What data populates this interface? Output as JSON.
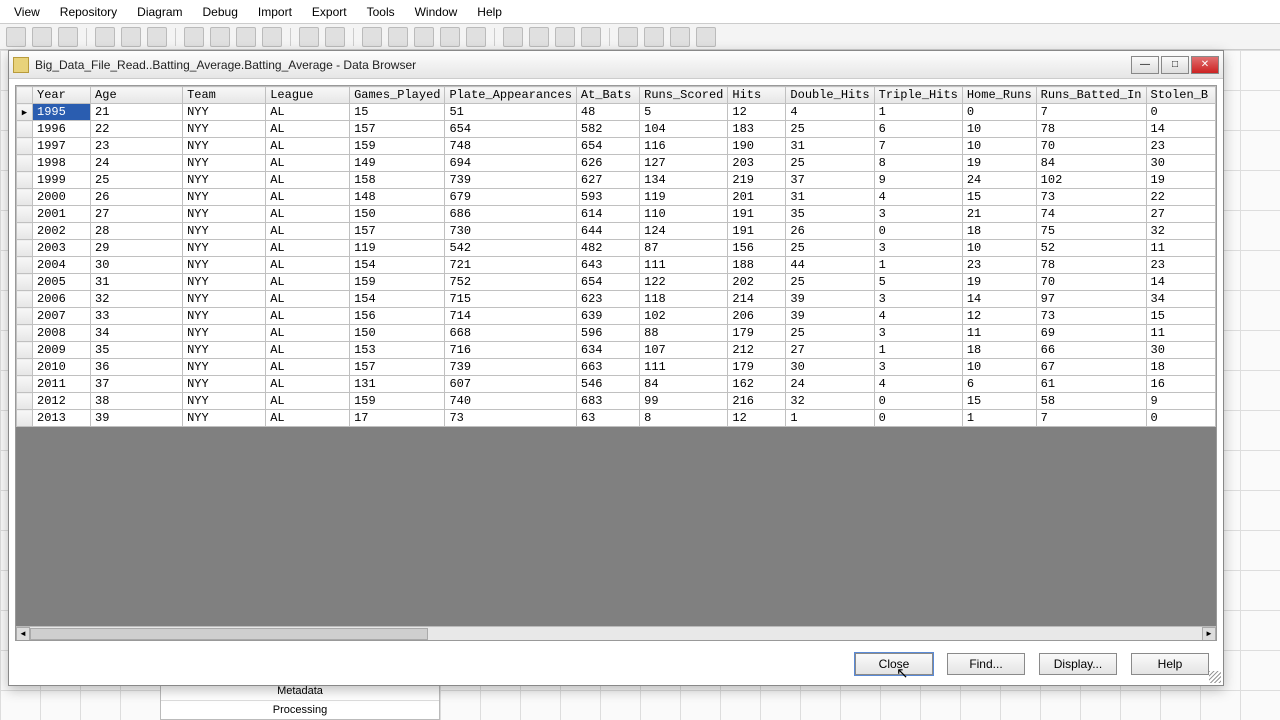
{
  "menubar": [
    "View",
    "Repository",
    "Diagram",
    "Debug",
    "Import",
    "Export",
    "Tools",
    "Window",
    "Help"
  ],
  "dialog": {
    "title": "Big_Data_File_Read..Batting_Average.Batting_Average - Data Browser"
  },
  "table": {
    "columns": [
      "Year",
      "Age",
      "Team",
      "League",
      "Games_Played",
      "Plate_Appearances",
      "At_Bats",
      "Runs_Scored",
      "Hits",
      "Double_Hits",
      "Triple_Hits",
      "Home_Runs",
      "Runs_Batted_In",
      "Stolen_B"
    ],
    "rows": [
      {
        "Year": "1995",
        "Age": "21",
        "Team": "NYY",
        "League": "AL",
        "Games_Played": "15",
        "Plate_Appearances": "51",
        "At_Bats": "48",
        "Runs_Scored": "5",
        "Hits": "12",
        "Double_Hits": "4",
        "Triple_Hits": "1",
        "Home_Runs": "0",
        "Runs_Batted_In": "7",
        "Stolen_B": "0"
      },
      {
        "Year": "1996",
        "Age": "22",
        "Team": "NYY",
        "League": "AL",
        "Games_Played": "157",
        "Plate_Appearances": "654",
        "At_Bats": "582",
        "Runs_Scored": "104",
        "Hits": "183",
        "Double_Hits": "25",
        "Triple_Hits": "6",
        "Home_Runs": "10",
        "Runs_Batted_In": "78",
        "Stolen_B": "14"
      },
      {
        "Year": "1997",
        "Age": "23",
        "Team": "NYY",
        "League": "AL",
        "Games_Played": "159",
        "Plate_Appearances": "748",
        "At_Bats": "654",
        "Runs_Scored": "116",
        "Hits": "190",
        "Double_Hits": "31",
        "Triple_Hits": "7",
        "Home_Runs": "10",
        "Runs_Batted_In": "70",
        "Stolen_B": "23"
      },
      {
        "Year": "1998",
        "Age": "24",
        "Team": "NYY",
        "League": "AL",
        "Games_Played": "149",
        "Plate_Appearances": "694",
        "At_Bats": "626",
        "Runs_Scored": "127",
        "Hits": "203",
        "Double_Hits": "25",
        "Triple_Hits": "8",
        "Home_Runs": "19",
        "Runs_Batted_In": "84",
        "Stolen_B": "30"
      },
      {
        "Year": "1999",
        "Age": "25",
        "Team": "NYY",
        "League": "AL",
        "Games_Played": "158",
        "Plate_Appearances": "739",
        "At_Bats": "627",
        "Runs_Scored": "134",
        "Hits": "219",
        "Double_Hits": "37",
        "Triple_Hits": "9",
        "Home_Runs": "24",
        "Runs_Batted_In": "102",
        "Stolen_B": "19"
      },
      {
        "Year": "2000",
        "Age": "26",
        "Team": "NYY",
        "League": "AL",
        "Games_Played": "148",
        "Plate_Appearances": "679",
        "At_Bats": "593",
        "Runs_Scored": "119",
        "Hits": "201",
        "Double_Hits": "31",
        "Triple_Hits": "4",
        "Home_Runs": "15",
        "Runs_Batted_In": "73",
        "Stolen_B": "22"
      },
      {
        "Year": "2001",
        "Age": "27",
        "Team": "NYY",
        "League": "AL",
        "Games_Played": "150",
        "Plate_Appearances": "686",
        "At_Bats": "614",
        "Runs_Scored": "110",
        "Hits": "191",
        "Double_Hits": "35",
        "Triple_Hits": "3",
        "Home_Runs": "21",
        "Runs_Batted_In": "74",
        "Stolen_B": "27"
      },
      {
        "Year": "2002",
        "Age": "28",
        "Team": "NYY",
        "League": "AL",
        "Games_Played": "157",
        "Plate_Appearances": "730",
        "At_Bats": "644",
        "Runs_Scored": "124",
        "Hits": "191",
        "Double_Hits": "26",
        "Triple_Hits": "0",
        "Home_Runs": "18",
        "Runs_Batted_In": "75",
        "Stolen_B": "32"
      },
      {
        "Year": "2003",
        "Age": "29",
        "Team": "NYY",
        "League": "AL",
        "Games_Played": "119",
        "Plate_Appearances": "542",
        "At_Bats": "482",
        "Runs_Scored": "87",
        "Hits": "156",
        "Double_Hits": "25",
        "Triple_Hits": "3",
        "Home_Runs": "10",
        "Runs_Batted_In": "52",
        "Stolen_B": "11"
      },
      {
        "Year": "2004",
        "Age": "30",
        "Team": "NYY",
        "League": "AL",
        "Games_Played": "154",
        "Plate_Appearances": "721",
        "At_Bats": "643",
        "Runs_Scored": "111",
        "Hits": "188",
        "Double_Hits": "44",
        "Triple_Hits": "1",
        "Home_Runs": "23",
        "Runs_Batted_In": "78",
        "Stolen_B": "23"
      },
      {
        "Year": "2005",
        "Age": "31",
        "Team": "NYY",
        "League": "AL",
        "Games_Played": "159",
        "Plate_Appearances": "752",
        "At_Bats": "654",
        "Runs_Scored": "122",
        "Hits": "202",
        "Double_Hits": "25",
        "Triple_Hits": "5",
        "Home_Runs": "19",
        "Runs_Batted_In": "70",
        "Stolen_B": "14"
      },
      {
        "Year": "2006",
        "Age": "32",
        "Team": "NYY",
        "League": "AL",
        "Games_Played": "154",
        "Plate_Appearances": "715",
        "At_Bats": "623",
        "Runs_Scored": "118",
        "Hits": "214",
        "Double_Hits": "39",
        "Triple_Hits": "3",
        "Home_Runs": "14",
        "Runs_Batted_In": "97",
        "Stolen_B": "34"
      },
      {
        "Year": "2007",
        "Age": "33",
        "Team": "NYY",
        "League": "AL",
        "Games_Played": "156",
        "Plate_Appearances": "714",
        "At_Bats": "639",
        "Runs_Scored": "102",
        "Hits": "206",
        "Double_Hits": "39",
        "Triple_Hits": "4",
        "Home_Runs": "12",
        "Runs_Batted_In": "73",
        "Stolen_B": "15"
      },
      {
        "Year": "2008",
        "Age": "34",
        "Team": "NYY",
        "League": "AL",
        "Games_Played": "150",
        "Plate_Appearances": "668",
        "At_Bats": "596",
        "Runs_Scored": "88",
        "Hits": "179",
        "Double_Hits": "25",
        "Triple_Hits": "3",
        "Home_Runs": "11",
        "Runs_Batted_In": "69",
        "Stolen_B": "11"
      },
      {
        "Year": "2009",
        "Age": "35",
        "Team": "NYY",
        "League": "AL",
        "Games_Played": "153",
        "Plate_Appearances": "716",
        "At_Bats": "634",
        "Runs_Scored": "107",
        "Hits": "212",
        "Double_Hits": "27",
        "Triple_Hits": "1",
        "Home_Runs": "18",
        "Runs_Batted_In": "66",
        "Stolen_B": "30"
      },
      {
        "Year": "2010",
        "Age": "36",
        "Team": "NYY",
        "League": "AL",
        "Games_Played": "157",
        "Plate_Appearances": "739",
        "At_Bats": "663",
        "Runs_Scored": "111",
        "Hits": "179",
        "Double_Hits": "30",
        "Triple_Hits": "3",
        "Home_Runs": "10",
        "Runs_Batted_In": "67",
        "Stolen_B": "18"
      },
      {
        "Year": "2011",
        "Age": "37",
        "Team": "NYY",
        "League": "AL",
        "Games_Played": "131",
        "Plate_Appearances": "607",
        "At_Bats": "546",
        "Runs_Scored": "84",
        "Hits": "162",
        "Double_Hits": "24",
        "Triple_Hits": "4",
        "Home_Runs": "6",
        "Runs_Batted_In": "61",
        "Stolen_B": "16"
      },
      {
        "Year": "2012",
        "Age": "38",
        "Team": "NYY",
        "League": "AL",
        "Games_Played": "159",
        "Plate_Appearances": "740",
        "At_Bats": "683",
        "Runs_Scored": "99",
        "Hits": "216",
        "Double_Hits": "32",
        "Triple_Hits": "0",
        "Home_Runs": "15",
        "Runs_Batted_In": "58",
        "Stolen_B": "9"
      },
      {
        "Year": "2013",
        "Age": "39",
        "Team": "NYY",
        "League": "AL",
        "Games_Played": "17",
        "Plate_Appearances": "73",
        "At_Bats": "63",
        "Runs_Scored": "8",
        "Hits": "12",
        "Double_Hits": "1",
        "Triple_Hits": "0",
        "Home_Runs": "1",
        "Runs_Batted_In": "7",
        "Stolen_B": "0"
      }
    ],
    "selected_row": 0
  },
  "buttons": {
    "close": "Close",
    "find": "Find...",
    "display": "Display...",
    "help": "Help"
  },
  "bottom_panel": {
    "metadata": "Metadata",
    "processing": "Processing"
  }
}
